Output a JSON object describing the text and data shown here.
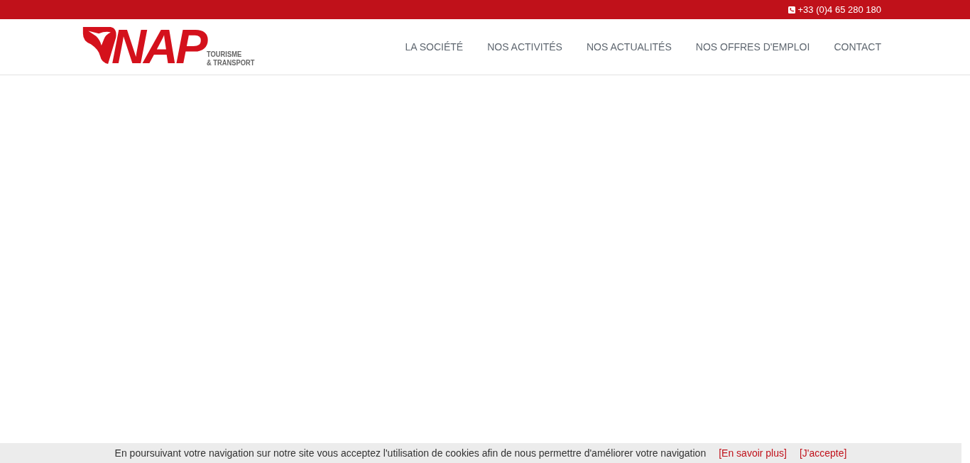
{
  "topbar": {
    "phone": "+33 (0)4 65 280 180"
  },
  "logo": {
    "name": "NAP",
    "line1": "TOURISME",
    "line2": "& TRANSPORT"
  },
  "nav": [
    {
      "label": "LA SOCIÉTÉ"
    },
    {
      "label": "NOS ACTIVITÉS"
    },
    {
      "label": "NOS ACTUALITÉS"
    },
    {
      "label": "NOS OFFRES D'EMPLOI"
    },
    {
      "label": "CONTACT"
    }
  ],
  "cookie_bar": {
    "message": "En poursuivant votre navigation sur notre site vous acceptez l'utilisation de cookies afin de nous permettre d'améliorer votre navigation",
    "links": [
      "[En savoir plus]",
      "[J'accepte]"
    ]
  }
}
